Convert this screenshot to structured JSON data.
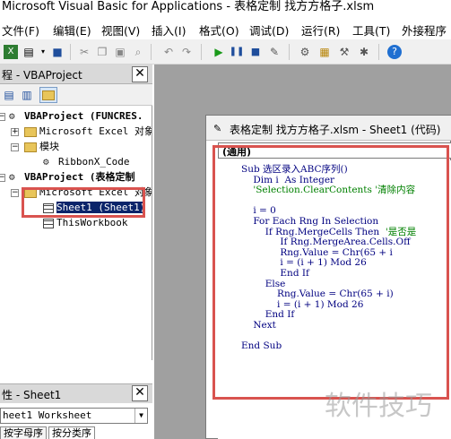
{
  "window": {
    "title": "Microsoft Visual Basic for Applications - 表格定制 找方方格子.xlsm"
  },
  "menu": [
    "文件(F)",
    "编辑(E)",
    "视图(V)",
    "插入(I)",
    "格式(O)",
    "调试(D)",
    "运行(R)",
    "工具(T)",
    "外接程序"
  ],
  "project_pane": {
    "title": "程 - VBAProject",
    "close": "✕",
    "tree": [
      {
        "label": "VBAProject (FUNCRES.",
        "expander": "−"
      },
      {
        "label": "Microsoft Excel 对象",
        "expander": "+"
      },
      {
        "label": "模块",
        "expander": "−"
      },
      {
        "label": "RibbonX_Code"
      },
      {
        "label": "VBAProject (表格定制",
        "expander": "−"
      },
      {
        "label": "Microsoft Excel 对象",
        "expander": "−"
      },
      {
        "label": "Sheet1 (Sheet1)",
        "selected": true
      },
      {
        "label": "ThisWorkbook"
      }
    ]
  },
  "properties_pane": {
    "title": "性 - Sheet1",
    "close": "✕",
    "object_select": "heet1 Worksheet",
    "tabs": [
      "按字母序",
      "按分类序"
    ]
  },
  "code_window": {
    "title": "表格定制 找方方格子.xlsm - Sheet1 (代码)",
    "object_combo": "(通用)",
    "lines": [
      {
        "code": "Sub 选区录入ABC序列()"
      },
      {
        "code": "    Dim i  As Integer"
      },
      {
        "code": "    'Selection.ClearContents '清除内容",
        "comment": true
      },
      {
        "code": ""
      },
      {
        "code": "    i = 0"
      },
      {
        "code": "    For Each Rng In Selection"
      },
      {
        "code": "        If Rng.MergeCells Then  '是否是",
        "mixed": true
      },
      {
        "code": "             If Rng.MergeArea.Cells.Off"
      },
      {
        "code": "             Rng.Value = Chr(65 + i"
      },
      {
        "code": "             i = (i + 1) Mod 26"
      },
      {
        "code": "             End If"
      },
      {
        "code": "        Else"
      },
      {
        "code": "            Rng.Value = Chr(65 + i)"
      },
      {
        "code": "            i = (i + 1) Mod 26"
      },
      {
        "code": "        End If"
      },
      {
        "code": "    Next"
      },
      {
        "code": ""
      },
      {
        "code": "End Sub"
      }
    ]
  },
  "watermark": "软件技巧",
  "colors": {
    "highlight": "#d9534f",
    "selection": "#0a246a",
    "keyword": "#000080",
    "comment": "#008000"
  }
}
